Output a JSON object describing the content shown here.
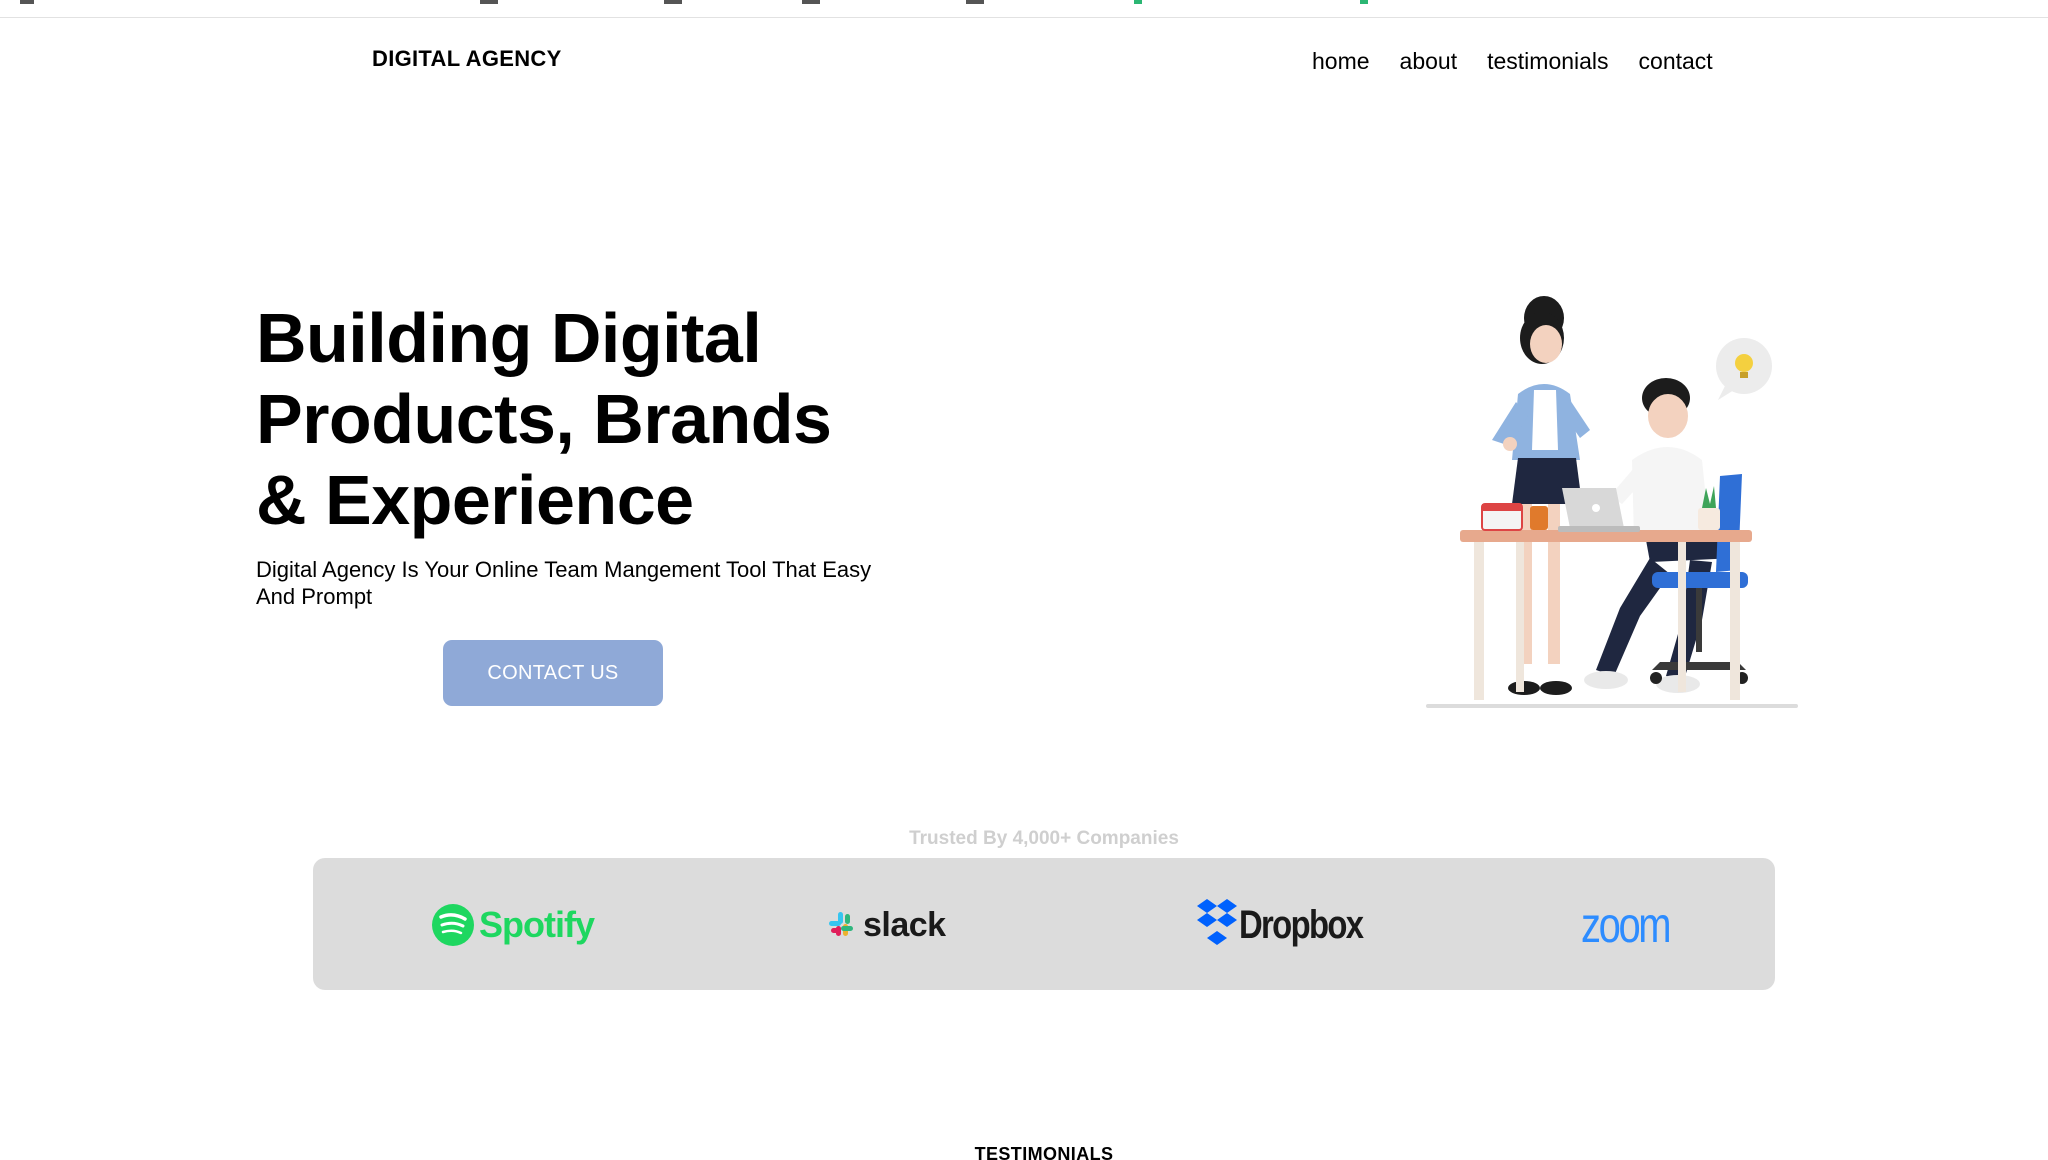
{
  "header": {
    "brand": "DIGITAL AGENCY",
    "nav": [
      "home",
      "about",
      "testimonials",
      "contact"
    ]
  },
  "hero": {
    "title_lines": [
      "Building Digital",
      "Products, Brands",
      "& Experience"
    ],
    "subtitle": "Digital Agency Is Your Online Team Mangement Tool That Easy And Prompt",
    "cta_label": "CONTACT US"
  },
  "trusted": {
    "label": "Trusted By 4,000+ Companies",
    "logos": [
      "Spotify",
      "slack",
      "Dropbox",
      "zoom"
    ]
  },
  "sections": {
    "testimonials_title": "TESTIMONIALS"
  },
  "colors": {
    "cta": "#8fa9d7",
    "logo_bar": "#dcdcdc",
    "spotify": "#1ed760",
    "dropbox": "#0061fe",
    "zoom": "#2d8cff"
  }
}
